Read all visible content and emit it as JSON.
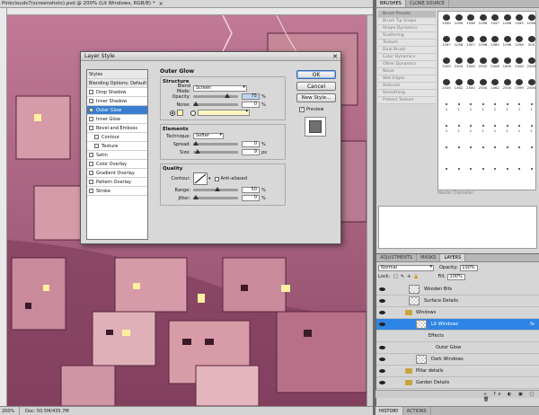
{
  "document": {
    "tab_title": "Pinkclouds7(screenshots).psd @ 200% (Lit Windows, RGB/8) *",
    "close": "×",
    "zoom": "200%",
    "doc_size": "Doc: 50.5M/435.7M"
  },
  "dialog": {
    "title": "Layer Style",
    "close": "✕",
    "styles_header": "Styles",
    "blending": "Blending Options: Default",
    "effects": [
      {
        "label": "Drop Shadow",
        "checked": false,
        "sub": false,
        "selected": false
      },
      {
        "label": "Inner Shadow",
        "checked": false,
        "sub": false,
        "selected": false
      },
      {
        "label": "Outer Glow",
        "checked": true,
        "sub": false,
        "selected": true
      },
      {
        "label": "Inner Glow",
        "checked": false,
        "sub": false,
        "selected": false
      },
      {
        "label": "Bevel and Emboss",
        "checked": false,
        "sub": false,
        "selected": false
      },
      {
        "label": "Contour",
        "checked": false,
        "sub": true,
        "selected": false
      },
      {
        "label": "Texture",
        "checked": false,
        "sub": true,
        "selected": false
      },
      {
        "label": "Satin",
        "checked": false,
        "sub": false,
        "selected": false
      },
      {
        "label": "Color Overlay",
        "checked": false,
        "sub": false,
        "selected": false
      },
      {
        "label": "Gradient Overlay",
        "checked": false,
        "sub": false,
        "selected": false
      },
      {
        "label": "Pattern Overlay",
        "checked": false,
        "sub": false,
        "selected": false
      },
      {
        "label": "Stroke",
        "checked": false,
        "sub": false,
        "selected": false
      }
    ],
    "outer_glow": {
      "title": "Outer Glow",
      "structure": "Structure",
      "blend_mode_label": "Blend Mode:",
      "blend_mode": "Screen",
      "opacity_label": "Opacity:",
      "opacity": "75",
      "noise_label": "Noise:",
      "noise": "0",
      "percent": "%",
      "glow_color": "#fff5a8",
      "elements": "Elements",
      "technique_label": "Technique:",
      "technique": "Softer",
      "spread_label": "Spread:",
      "spread": "0",
      "size_label": "Size:",
      "size": "9",
      "px": "px",
      "quality": "Quality",
      "contour_label": "Contour:",
      "anti_aliased": "Anti-aliased",
      "range_label": "Range:",
      "range": "50",
      "jitter_label": "Jitter:",
      "jitter": "0"
    },
    "buttons": {
      "ok": "OK",
      "cancel": "Cancel",
      "new_style": "New Style...",
      "preview": "Preview"
    }
  },
  "brushes": {
    "tabs": [
      "BRUSHES",
      "CLONE SOURCE"
    ],
    "presets": [
      "Brush Presets",
      "Brush Tip Shape",
      "Shape Dynamics",
      "Scattering",
      "Texture",
      "Dual Brush",
      "Color Dynamics",
      "Other Dynamics",
      "Noise",
      "Wet Edges",
      "Airbrush",
      "Smoothing",
      "Protect Texture"
    ],
    "tip_sizes": [
      "1090",
      "1099",
      "1096",
      "1098",
      "1097",
      "1096",
      "1095",
      "1099",
      "1097",
      "1056",
      "1007",
      "1096",
      "1080",
      "1096",
      "1096",
      "500",
      "2500",
      "2400",
      "2000",
      "2002",
      "2006",
      "1600",
      "2500",
      "2500",
      "2500",
      "1462",
      "2500",
      "2500",
      "1462",
      "2500",
      "1599",
      "2500",
      "1",
      "1",
      "1",
      "1",
      "1",
      "1",
      "1",
      "1",
      "1",
      "1",
      "1",
      "1",
      "1",
      "1",
      "1",
      "1",
      "",
      "",
      "",
      "",
      "",
      "",
      "",
      "",
      "",
      "",
      "",
      "",
      "",
      "",
      "",
      ""
    ],
    "master_diameter": "Master Diameter"
  },
  "layers": {
    "tabs": [
      "ADJUSTMENTS",
      "MASKS",
      "LAYERS"
    ],
    "blend_mode": "Normal",
    "opacity_label": "Opacity:",
    "opacity": "100%",
    "lock_label": "Lock:",
    "fill_label": "Fill:",
    "fill": "100%",
    "items": [
      {
        "name": "Wooden Bits",
        "kind": "layer",
        "indent": 0,
        "selected": false,
        "visible": true
      },
      {
        "name": "Surface Details",
        "kind": "layer",
        "indent": 0,
        "selected": false,
        "visible": true
      },
      {
        "name": "Windows",
        "kind": "group",
        "indent": 0,
        "selected": false,
        "visible": true
      },
      {
        "name": "Lit Windows",
        "kind": "layer",
        "indent": 1,
        "selected": true,
        "visible": true
      },
      {
        "name": "Effects",
        "kind": "effects",
        "indent": 2,
        "selected": false,
        "visible": false
      },
      {
        "name": "Outer Glow",
        "kind": "effect",
        "indent": 3,
        "selected": false,
        "visible": true
      },
      {
        "name": "Dark Windows",
        "kind": "layer",
        "indent": 1,
        "selected": false,
        "visible": true
      },
      {
        "name": "Pillar details",
        "kind": "group",
        "indent": 0,
        "selected": false,
        "visible": true
      },
      {
        "name": "Garden Details",
        "kind": "group",
        "indent": 0,
        "selected": false,
        "visible": true
      }
    ],
    "fx": "fx"
  },
  "history_tabs": [
    "HISTORY",
    "ACTIONS"
  ]
}
